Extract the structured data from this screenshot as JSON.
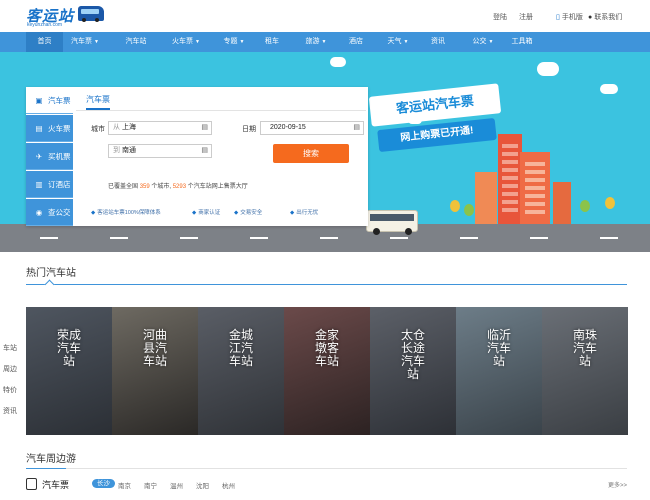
{
  "header": {
    "logo_text": "客运站",
    "logo_sub": "keyunzhan.com",
    "login": "登陆",
    "register": "注册",
    "mobile": "手机版",
    "contact": "联系我们"
  },
  "nav": {
    "items": [
      {
        "label": "首页",
        "caret": false
      },
      {
        "label": "汽车票",
        "caret": true
      },
      {
        "label": "汽车站",
        "caret": false
      },
      {
        "label": "火车票",
        "caret": true
      },
      {
        "label": "专题",
        "caret": true
      },
      {
        "label": "租车",
        "caret": false
      },
      {
        "label": "旅游",
        "caret": true
      },
      {
        "label": "酒店",
        "caret": false
      },
      {
        "label": "天气",
        "caret": true
      },
      {
        "label": "资讯",
        "caret": false
      },
      {
        "label": "公交",
        "caret": true
      },
      {
        "label": "工具箱",
        "caret": false
      }
    ]
  },
  "banner": {
    "title": "客运站汽车票",
    "subtitle": "网上购票已开通!"
  },
  "booking": {
    "side_tabs": [
      {
        "label": "汽车票",
        "icon": "bus-icon"
      },
      {
        "label": "火车票",
        "icon": "train-icon"
      },
      {
        "label": "买机票",
        "icon": "plane-icon"
      },
      {
        "label": "订酒店",
        "icon": "hotel-icon"
      },
      {
        "label": "查公交",
        "icon": "bus-stop-icon"
      }
    ],
    "form_tab": "汽车票",
    "city_label": "城市",
    "from_prefix": "从",
    "from_value": "上海",
    "to_prefix": "到",
    "to_value": "南通",
    "date_label": "日期",
    "date_value": "2020-09-15",
    "search_button": "搜索",
    "stats_prefix": "已覆盖全国",
    "stats_cities": "359",
    "stats_mid": "个城市,",
    "stats_stations": "5293",
    "stats_suffix": "个汽车站网上售票大厅",
    "features": [
      "客运站车票100%保障体系",
      "商家认证",
      "交易安全",
      "出行无忧"
    ]
  },
  "hot_stations": {
    "title": "热门汽车站",
    "side_links": [
      "车站",
      "周边",
      "特价",
      "资讯"
    ],
    "cards": [
      {
        "name": "荣成汽车站",
        "lines": [
          "荣成",
          "汽车",
          "站"
        ],
        "bg1": "#4f5660",
        "bg2": "#2b2f35"
      },
      {
        "name": "河曲县汽车站",
        "lines": [
          "河曲",
          "县汽",
          "车站"
        ],
        "bg1": "#6e6a62",
        "bg2": "#2a2826"
      },
      {
        "name": "金城江汽车站",
        "lines": [
          "金城",
          "江汽",
          "车站"
        ],
        "bg1": "#5a5e66",
        "bg2": "#2f3237"
      },
      {
        "name": "金家墩客车站",
        "lines": [
          "金家",
          "墩客",
          "车站"
        ],
        "bg1": "#6b4a4a",
        "bg2": "#2c2222"
      },
      {
        "name": "太仓长途汽车站",
        "lines": [
          "太仓",
          "长途",
          "汽车",
          "站"
        ],
        "bg1": "#5c6068",
        "bg2": "#2d3036"
      },
      {
        "name": "临沂汽车站",
        "lines": [
          "临沂",
          "汽车",
          "站"
        ],
        "bg1": "#6d7d88",
        "bg2": "#3a434a"
      },
      {
        "name": "南珠汽车站",
        "lines": [
          "南珠",
          "汽车",
          "站"
        ],
        "bg1": "#6a6f76",
        "bg2": "#3a3e43"
      }
    ]
  },
  "tour": {
    "title": "汽车周边游",
    "bar_label": "汽车票",
    "cities": [
      "长沙",
      "南京",
      "南宁",
      "温州",
      "沈阳",
      "杭州"
    ],
    "active_city": "长沙",
    "more": "更多>>"
  },
  "colors": {
    "nav_blue": "#3f94da",
    "banner_sky": "#3bc3e0",
    "search_orange": "#f56a1e",
    "link_blue": "#1a73c9"
  }
}
